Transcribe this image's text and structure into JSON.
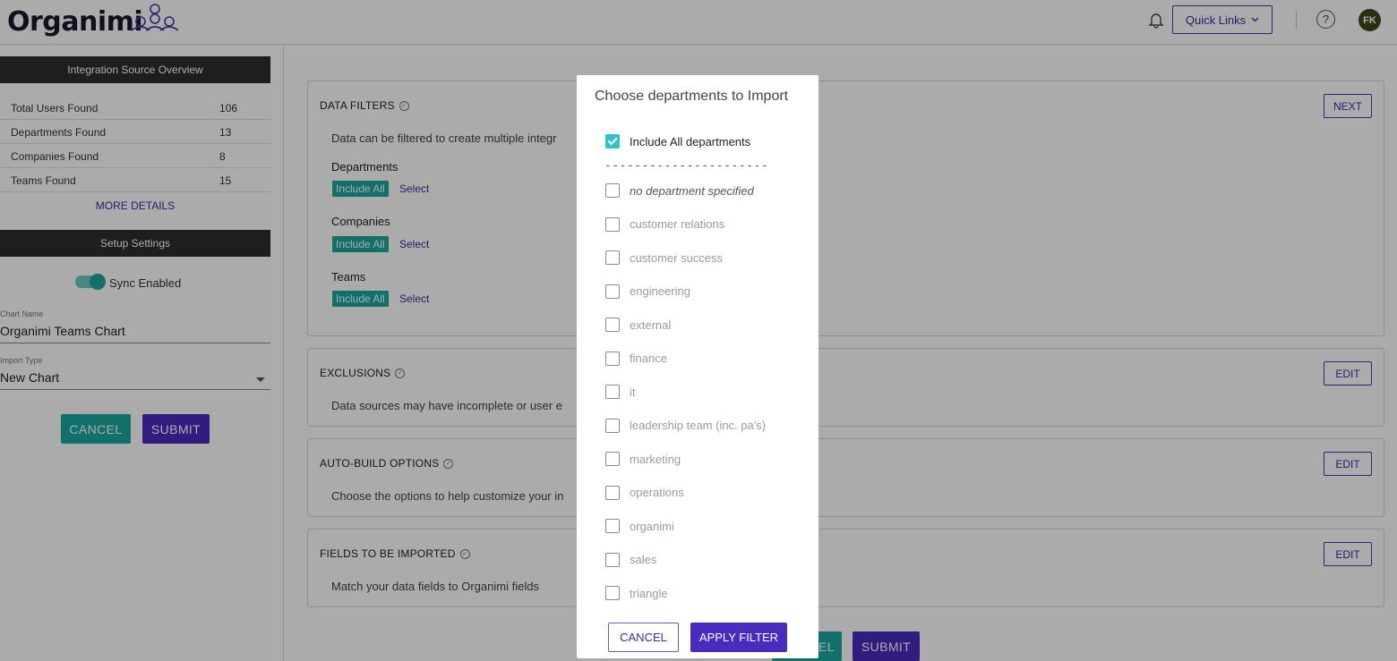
{
  "header": {
    "logo_text": "Organimi",
    "quick_links": "Quick Links",
    "help_symbol": "?",
    "avatar_initials": "FK",
    "icons": [
      "bell-icon",
      "chevron-down-icon",
      "help-icon"
    ]
  },
  "sidebar": {
    "overview_title": "Integration Source Overview",
    "stats": [
      {
        "label": "Total Users Found",
        "value": "106"
      },
      {
        "label": "Departments Found",
        "value": "13"
      },
      {
        "label": "Companies Found",
        "value": "8"
      },
      {
        "label": "Teams Found",
        "value": "15"
      }
    ],
    "more_details": "MORE DETAILS",
    "setup_title": "Setup Settings",
    "sync_label": "Sync Enabled",
    "sync_enabled": true,
    "chart_name_label": "Chart Name",
    "chart_name_value": "Organimi Teams Chart",
    "import_type_label": "Import Type",
    "import_type_value": "New Chart",
    "cancel": "CANCEL",
    "submit": "SUBMIT"
  },
  "main": {
    "data_filters": {
      "title": "DATA FILTERS",
      "next": "NEXT",
      "desc": "Data can be filtered to create multiple integr",
      "groups": [
        {
          "label": "Departments",
          "tag": "Include All",
          "link": "Select"
        },
        {
          "label": "Companies",
          "tag": "Include All",
          "link": "Select"
        },
        {
          "label": "Teams",
          "tag": "Include All",
          "link": "Select"
        }
      ]
    },
    "exclusions": {
      "title": "EXCLUSIONS",
      "desc": "Data sources may have incomplete or user e",
      "button": "EDIT"
    },
    "auto_build": {
      "title": "AUTO-BUILD OPTIONS",
      "desc": "Choose the options to help customize your in",
      "button": "EDIT"
    },
    "fields": {
      "title": "FIELDS TO BE IMPORTED",
      "desc": "Match your data fields to Organimi fields",
      "button": "EDIT"
    },
    "bottom_cancel_fragment": "EL",
    "bottom_submit": "SUBMIT"
  },
  "modal": {
    "title": "Choose departments to Import",
    "include_all": "Include All departments",
    "dashes": "----------------------",
    "departments": [
      "no department specified",
      "customer relations",
      "customer success",
      "engineering",
      "external",
      "finance",
      "it",
      "leadership team (inc. pa's)",
      "marketing",
      "operations",
      "organimi",
      "sales",
      "triangle"
    ],
    "cancel": "CANCEL",
    "apply": "APPLY FILTER"
  },
  "colors": {
    "teal": "#1aa99f",
    "purple": "#4a2bbf",
    "checkbox_checked": "#2fc1c4",
    "dark_bar": "#2e2e2e"
  }
}
